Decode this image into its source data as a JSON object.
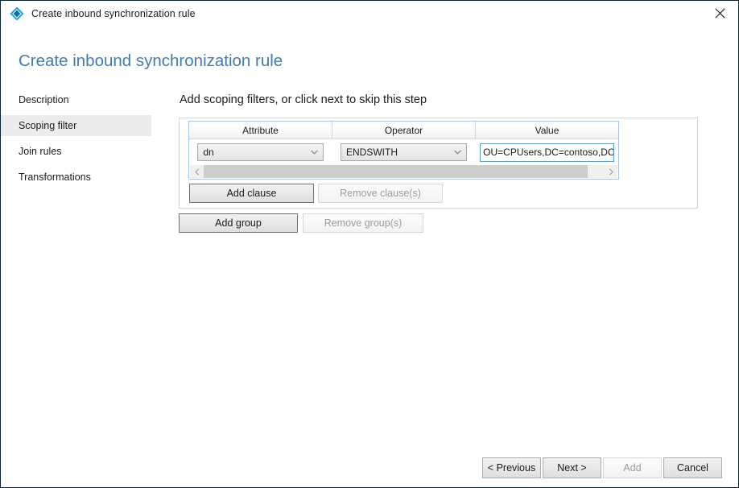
{
  "titlebar": {
    "icon": "azure-diamond-icon",
    "title": "Create inbound synchronization rule",
    "close_label": "close-icon"
  },
  "page": {
    "heading": "Create inbound synchronization rule",
    "heading_color": "#3f7cb3"
  },
  "sidebar": {
    "items": [
      {
        "label": "Description",
        "selected": false
      },
      {
        "label": "Scoping filter",
        "selected": true
      },
      {
        "label": "Join rules",
        "selected": false
      },
      {
        "label": "Transformations",
        "selected": false
      }
    ],
    "selected_bg": "#ececec"
  },
  "main": {
    "instruction": "Add scoping filters, or click next to skip this step",
    "clause_table": {
      "columns": [
        "Attribute",
        "Operator",
        "Value"
      ],
      "rows": [
        {
          "attribute": "dn",
          "operator": "ENDSWITH",
          "value": "OU=CPUsers,DC=contoso,DC=con",
          "value_full": "OU=CPUsers,DC=contoso,DC=com"
        }
      ],
      "focus_border_color": "#5b9bd5",
      "scrollbar": {
        "left_arrow": "chevron-left-icon",
        "right_arrow": "chevron-right-icon",
        "thumb_width_pct": 96
      }
    },
    "clause_buttons": [
      {
        "label": "Add clause",
        "enabled": true
      },
      {
        "label": "Remove clause(s)",
        "enabled": false
      }
    ],
    "group_buttons": [
      {
        "label": "Add group",
        "enabled": true
      },
      {
        "label": "Remove group(s)",
        "enabled": false
      }
    ]
  },
  "footer": {
    "buttons": [
      {
        "label": "< Previous",
        "enabled": true
      },
      {
        "label": "Next >",
        "enabled": true
      },
      {
        "label": "Add",
        "enabled": false
      },
      {
        "label": "Cancel",
        "enabled": true
      }
    ]
  }
}
